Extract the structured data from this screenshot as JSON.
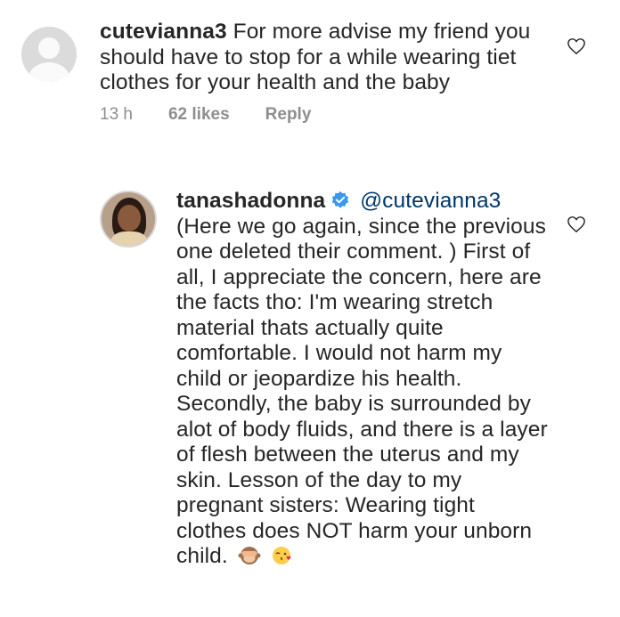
{
  "comments": [
    {
      "username": "cutevianna3",
      "text": "For more advise my friend you should have to stop for a while wearing tiet clothes for your health and the baby",
      "time": "13 h",
      "likes": "62 likes",
      "reply_label": "Reply",
      "avatar_icon": "default-avatar-icon",
      "like_icon": "heart-outline-icon"
    },
    {
      "username": "tanashadonna",
      "mention": "@cutevianna3",
      "text": "(Here we go again, since the previous one deleted their comment. ) First of all, I appreciate the concern, here are the facts tho: I'm wearing stretch material thats actually quite comfortable. I would not harm my child or jeopardize his health. Secondly, the baby is surrounded by alot of body fluids, and there is a layer of flesh between the uterus and my skin. Lesson of the day to my pregnant sisters: Wearing tight clothes does NOT harm your unborn child.",
      "emojis": [
        "see-no-evil-monkey-icon",
        "face-blowing-kiss-icon"
      ],
      "verified_icon": "verified-badge-icon",
      "like_icon": "heart-outline-icon"
    }
  ],
  "colors": {
    "text": "#262626",
    "meta": "#8e8e8e",
    "mention": "#00376b",
    "verified": "#3897f0"
  }
}
